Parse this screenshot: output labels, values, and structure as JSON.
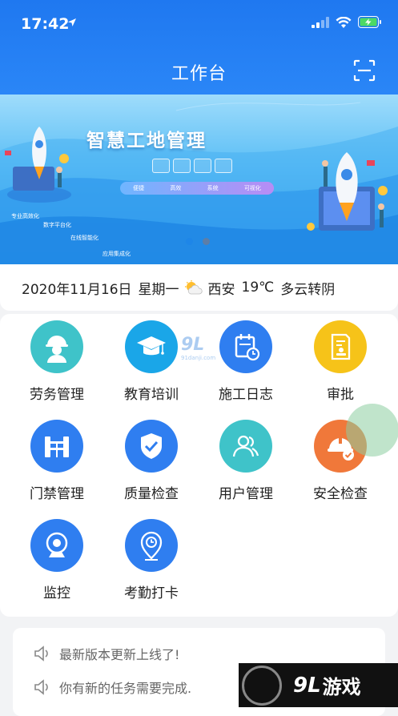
{
  "status_bar": {
    "time": "17:42"
  },
  "header": {
    "title": "工作台"
  },
  "banner": {
    "title": "智慧工地管理",
    "pill_items": [
      "便捷",
      "高效",
      "系统",
      "可视化"
    ],
    "tags": [
      "专业高效化",
      "数字平台化",
      "在线智能化",
      "应用集成化"
    ]
  },
  "date_bar": {
    "date": "2020年11月16日",
    "weekday": "星期一",
    "city": "西安",
    "temperature": "19℃",
    "weather": "多云转阴"
  },
  "grid": {
    "items": [
      {
        "label": "劳务管理",
        "icon": "worker-icon",
        "color": "#3fc3c9"
      },
      {
        "label": "教育培训",
        "icon": "graduation-cap-icon",
        "color": "#1aa6e8"
      },
      {
        "label": "施工日志",
        "icon": "calendar-log-icon",
        "color": "#2f7ef0"
      },
      {
        "label": "审批",
        "icon": "approval-doc-icon",
        "color": "#f6c319"
      },
      {
        "label": "门禁管理",
        "icon": "gate-icon",
        "color": "#2f7ef0"
      },
      {
        "label": "质量检查",
        "icon": "shield-check-icon",
        "color": "#2f7ef0"
      },
      {
        "label": "用户管理",
        "icon": "users-icon",
        "color": "#3fc3c9"
      },
      {
        "label": "安全检查",
        "icon": "safety-helmet-icon",
        "color": "#f0783a"
      },
      {
        "label": "监控",
        "icon": "camera-icon",
        "color": "#2f7ef0"
      },
      {
        "label": "考勤打卡",
        "icon": "clock-pin-icon",
        "color": "#2f7ef0"
      }
    ]
  },
  "notices": [
    {
      "text": "最新版本更新上线了!"
    },
    {
      "text": "你有新的任务需要完成."
    }
  ],
  "watermark": {
    "center": "9L",
    "center_small": "91danji.com",
    "corner_num": "9L",
    "corner_text": "游戏"
  }
}
